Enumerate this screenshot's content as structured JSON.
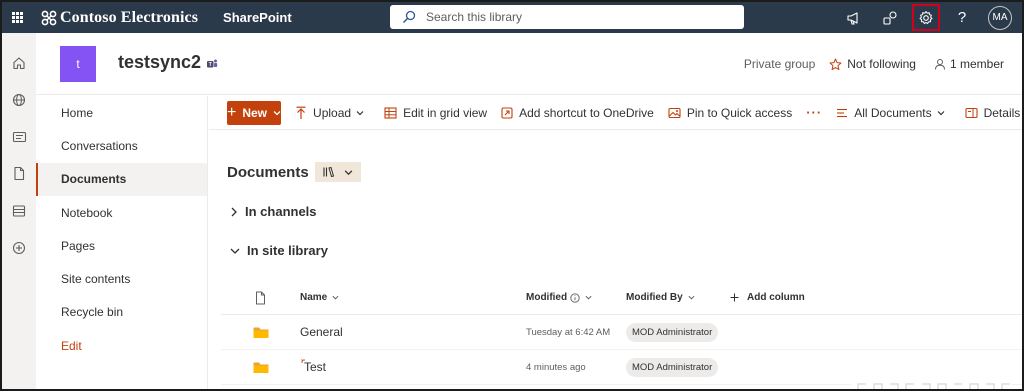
{
  "suitebar": {
    "brand": "Contoso Electronics",
    "app": "SharePoint",
    "search_placeholder": "Search this library",
    "avatar_initials": "MA"
  },
  "site": {
    "logo_letter": "t",
    "title": "testsync2",
    "privacy": "Private group",
    "follow": "Not following",
    "members": "1 member"
  },
  "nav": {
    "items": [
      {
        "label": "Home"
      },
      {
        "label": "Conversations"
      },
      {
        "label": "Documents"
      },
      {
        "label": "Notebook"
      },
      {
        "label": "Pages"
      },
      {
        "label": "Site contents"
      },
      {
        "label": "Recycle bin"
      },
      {
        "label": "Edit"
      }
    ]
  },
  "commands": {
    "new": "New",
    "upload": "Upload",
    "grid": "Edit in grid view",
    "shortcut": "Add shortcut to OneDrive",
    "pin": "Pin to Quick access",
    "more": "···",
    "view": "All Documents",
    "details": "Details"
  },
  "main": {
    "title": "Documents",
    "groups": [
      {
        "label": "In channels"
      },
      {
        "label": "In site library"
      }
    ],
    "columns": {
      "name": "Name",
      "modified": "Modified",
      "modified_by": "Modified By",
      "add": "Add column"
    },
    "rows": [
      {
        "name": "General",
        "modified": "Tuesday at 6:42 AM",
        "modified_by": "MOD Administrator"
      },
      {
        "name": "Test",
        "modified": "4 minutes ago",
        "modified_by": "MOD Administrator"
      }
    ]
  },
  "colors": {
    "suitebar": "#2b3a4a",
    "accent": "#c2410c",
    "site_logo": "#8553f3",
    "folder": "#ffb900",
    "highlight_border": "#d0021b"
  }
}
